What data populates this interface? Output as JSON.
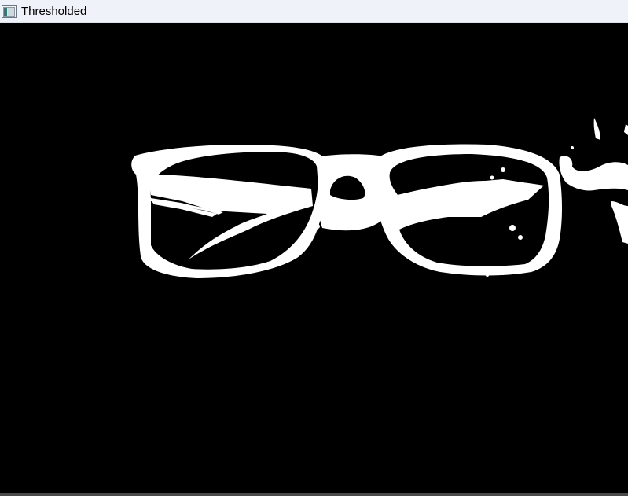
{
  "window": {
    "title": "Thresholded",
    "icon": "opencv-window-icon"
  },
  "image": {
    "subject": "thresholded-eyeglasses",
    "foreground_color": "#ffffff",
    "background_color": "#000000"
  },
  "colors": {
    "titlebar_bg": "#eff2f8",
    "title_text": "#000000",
    "window_bottom_border": "#4a4a4a"
  }
}
